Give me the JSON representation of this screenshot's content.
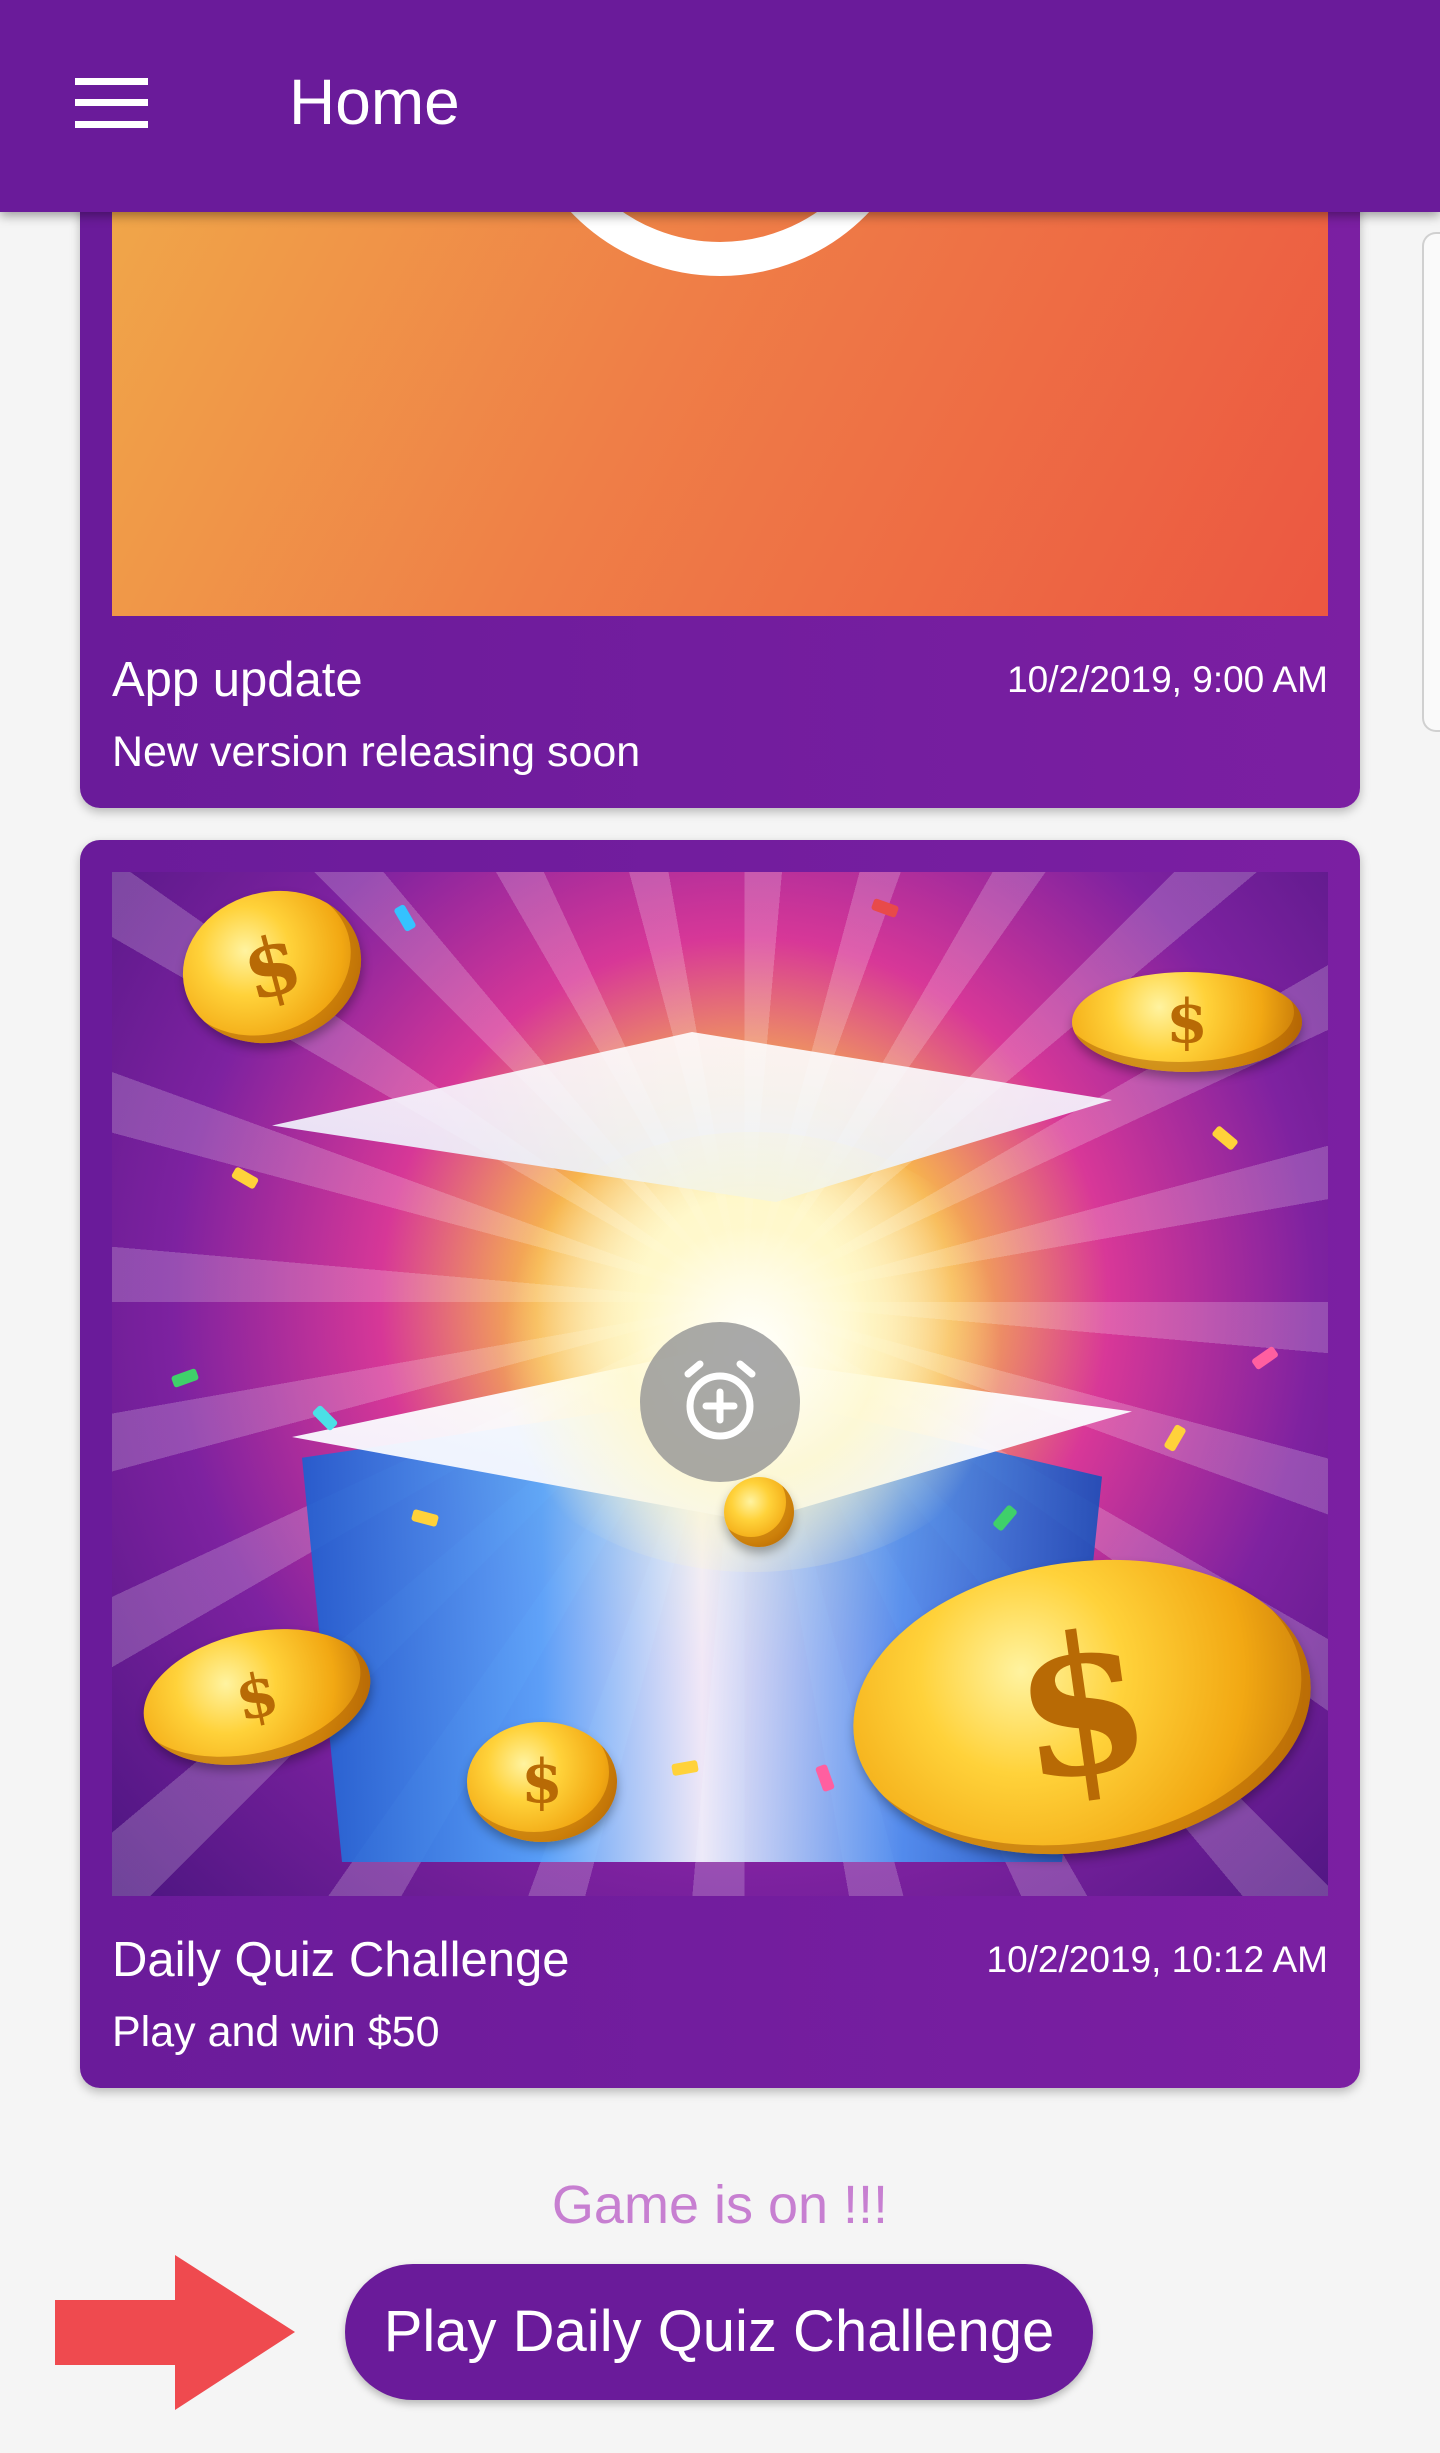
{
  "appbar": {
    "title": "Home",
    "menu_icon": "hamburger-menu-icon",
    "color": "#6a1b9a"
  },
  "cards": [
    {
      "title": "App update",
      "date": "10/2/2019, 9:00 AM",
      "subtitle": "New version releasing soon"
    },
    {
      "title": "Daily Quiz Challenge",
      "date": "10/2/2019, 10:12 AM",
      "subtitle": "Play and win $50",
      "overlay_icon": "add-alarm-icon"
    }
  ],
  "footer": {
    "status": "Game is on !!!",
    "status_color": "#c77fd1",
    "button_label": "Play Daily Quiz Challenge",
    "arrow_icon": "red-arrow-right-icon",
    "arrow_color": "#ef4a4f"
  }
}
